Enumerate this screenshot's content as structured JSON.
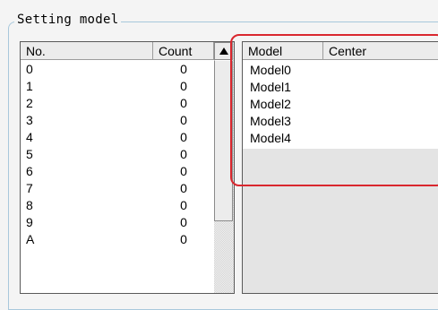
{
  "group": {
    "title": "Setting model"
  },
  "left_list": {
    "columns": [
      "No.",
      "Count"
    ],
    "rows": [
      {
        "no": "0",
        "count": "0"
      },
      {
        "no": "1",
        "count": "0"
      },
      {
        "no": "2",
        "count": "0"
      },
      {
        "no": "3",
        "count": "0"
      },
      {
        "no": "4",
        "count": "0"
      },
      {
        "no": "5",
        "count": "0"
      },
      {
        "no": "6",
        "count": "0"
      },
      {
        "no": "7",
        "count": "0"
      },
      {
        "no": "8",
        "count": "0"
      },
      {
        "no": "9",
        "count": "0"
      },
      {
        "no": "A",
        "count": "0"
      }
    ],
    "scroll_up_icon": "triangle-up"
  },
  "right_list": {
    "columns": [
      "Model",
      "Center"
    ],
    "rows": [
      "Model0",
      "Model1",
      "Model2",
      "Model3",
      "Model4"
    ]
  },
  "colors": {
    "highlight": "#d9272e",
    "group_border": "#a8c8dc"
  }
}
